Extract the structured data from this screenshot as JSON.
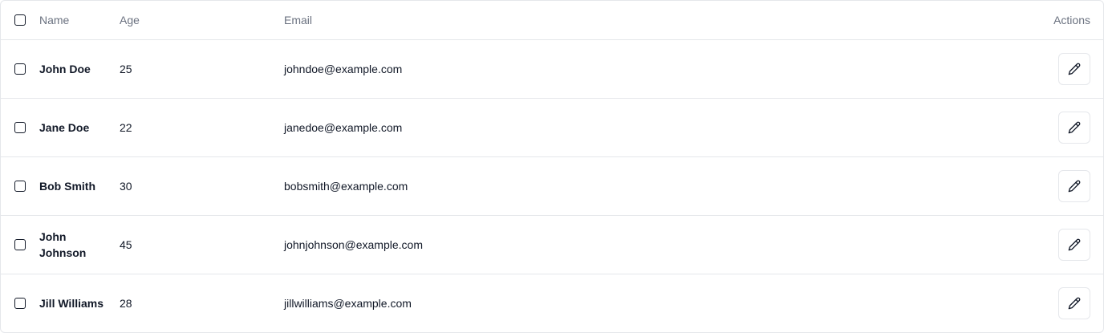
{
  "table": {
    "headers": {
      "name": "Name",
      "age": "Age",
      "email": "Email",
      "actions": "Actions"
    },
    "rows": [
      {
        "name": "John Doe",
        "age": "25",
        "email": "johndoe@example.com",
        "action_icon": "pencil-icon"
      },
      {
        "name": "Jane Doe",
        "age": "22",
        "email": "janedoe@example.com",
        "action_icon": "pencil-icon"
      },
      {
        "name": "Bob Smith",
        "age": "30",
        "email": "bobsmith@example.com",
        "action_icon": "pencil-icon"
      },
      {
        "name": "John Johnson",
        "age": "45",
        "email": "johnjohnson@example.com",
        "action_icon": "pencil-icon"
      },
      {
        "name": "Jill Williams",
        "age": "28",
        "email": "jillwilliams@example.com",
        "action_icon": "pencil-icon"
      }
    ]
  }
}
